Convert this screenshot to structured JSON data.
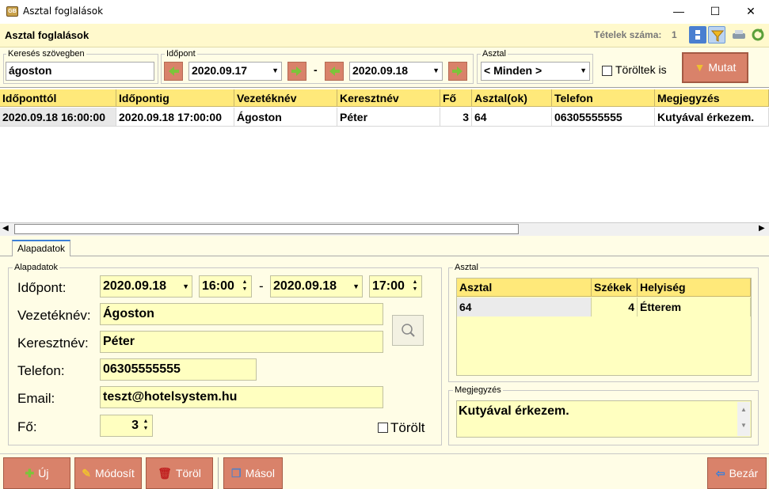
{
  "window": {
    "title": "Asztal foglalások",
    "minimize": "—",
    "maximize": "☐",
    "close": "✕",
    "icon_text": "GB"
  },
  "header": {
    "title": "Asztal foglalások",
    "count_label": "Tételek száma:",
    "count_value": "1"
  },
  "filter": {
    "search_legend": "Keresés szövegben",
    "search_value": "ágoston",
    "time_legend": "Időpont",
    "date_from": "2020.09.17",
    "date_to": "2020.09.18",
    "dash": "-",
    "table_legend": "Asztal",
    "table_value": "< Minden >",
    "deleted_label": "Töröltek is",
    "show_button": "Mutat"
  },
  "grid": {
    "columns": [
      "Időponttól",
      "Időpontig",
      "Vezetéknév",
      "Keresztnév",
      "Fő",
      "Asztal(ok)",
      "Telefon",
      "Megjegyzés"
    ],
    "rows": [
      [
        "2020.09.18 16:00:00",
        "2020.09.18 17:00:00",
        "Ágoston",
        "Péter",
        "3",
        "64",
        "06305555555",
        "Kutyával érkezem."
      ]
    ]
  },
  "tabs": [
    {
      "label": "Alapadatok"
    }
  ],
  "details": {
    "legend": "Alapadatok",
    "time_label": "Időpont:",
    "date_from": "2020.09.18",
    "time_from": "16:00",
    "dash": "-",
    "date_to": "2020.09.18",
    "time_to": "17:00",
    "lastname_label": "Vezetéknév:",
    "lastname": "Ágoston",
    "firstname_label": "Keresztnév:",
    "firstname": "Péter",
    "phone_label": "Telefon:",
    "phone": "06305555555",
    "email_label": "Email:",
    "email": "teszt@hotelsystem.hu",
    "guests_label": "Fő:",
    "guests": "3",
    "deleted_label": "Törölt"
  },
  "table_group": {
    "legend": "Asztal",
    "columns": [
      "Asztal",
      "Székek",
      "Helyiség"
    ],
    "rows": [
      [
        "64",
        "4",
        "Étterem"
      ]
    ]
  },
  "note_group": {
    "legend": "Megjegyzés",
    "text": "Kutyával érkezem."
  },
  "buttons": {
    "new": "Új",
    "modify": "Módosít",
    "delete": "Töröl",
    "copy": "Másol",
    "close": "Bezár"
  },
  "colors": {
    "accent_button": "#d9826a",
    "header_yellow": "#ffe97a",
    "field_yellow": "#ffffc0",
    "panel_bg": "#fffde6"
  }
}
